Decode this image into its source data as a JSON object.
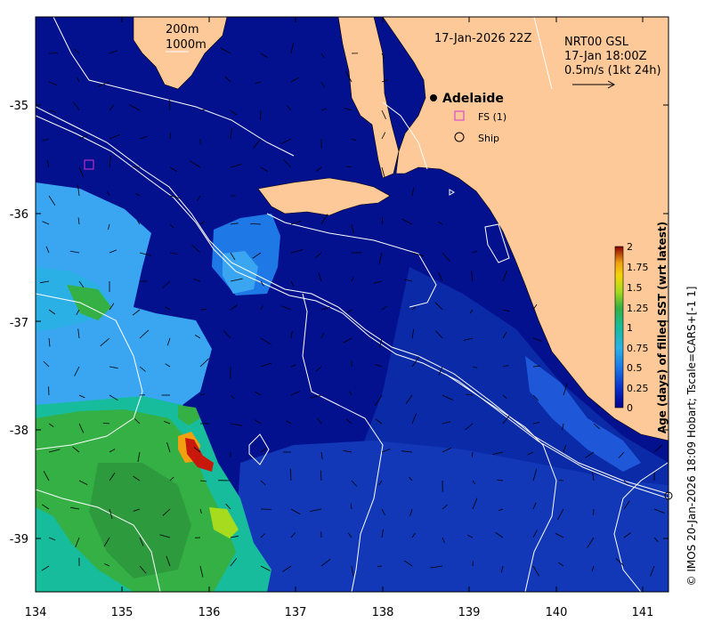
{
  "map": {
    "date_label": "17-Jan-2026 22Z",
    "product_label": "NRT00 GSL",
    "product_time": "17-Jan 18:00Z",
    "velocity_scale": "0.5m/s (1kt 24h)",
    "isobath_1": "200m",
    "isobath_2": "1000m",
    "city": "Adelaide",
    "legend_fs": "FS (1)",
    "legend_ship": "Ship",
    "credit": "© IMOS 20-Jan-2026 18:09 Hobart; Tscale=CARS+[-1 1]"
  },
  "axes": {
    "x_ticks": [
      "134",
      "135",
      "136",
      "137",
      "138",
      "139",
      "140",
      "141"
    ],
    "y_ticks": [
      "-35",
      "-36",
      "-37",
      "-38",
      "-39"
    ]
  },
  "colorbar": {
    "title": "Age (days) of filled SST (wrt latest)",
    "ticks": [
      "2",
      "1.75",
      "1.5",
      "1.25",
      "1",
      "0.75",
      "0.5",
      "0.25",
      "0"
    ]
  },
  "colors": {
    "land": "#fdc998",
    "ocean_deep": "#04118e",
    "ocean_mid": "#1640c9",
    "patch_blue": "#1e78e6",
    "patch_light": "#3aa6f2",
    "patch_cyan": "#16b7c3",
    "patch_teal": "#16bc9c",
    "patch_green": "#35b044",
    "patch_lime": "#a6db1e",
    "patch_orange": "#f0a010",
    "patch_red": "#c8180c"
  }
}
